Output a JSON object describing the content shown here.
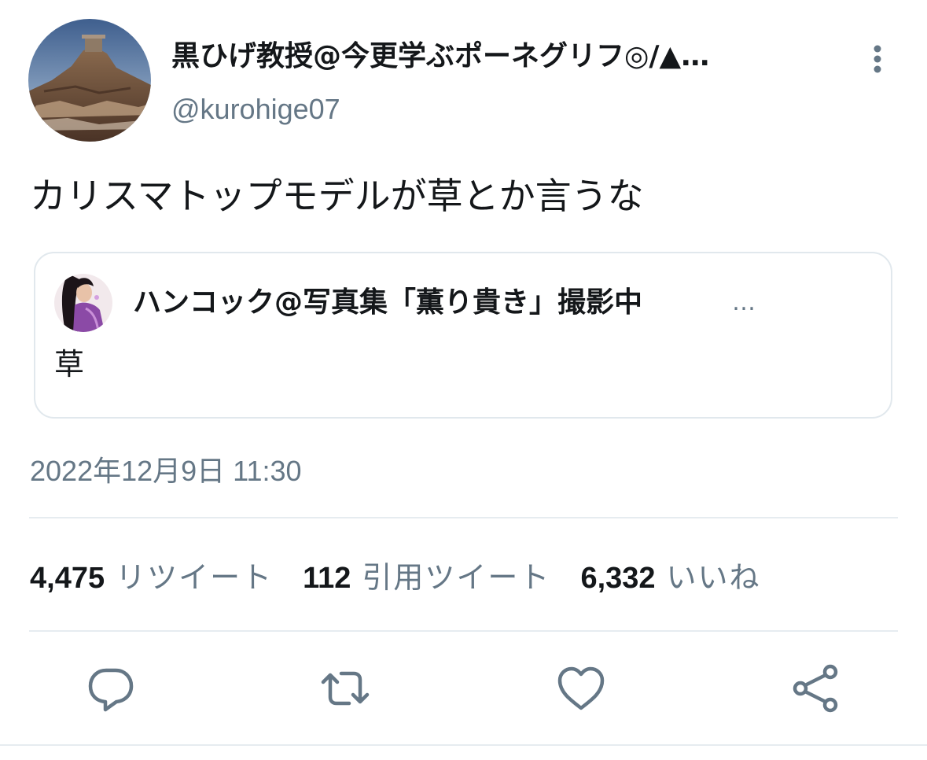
{
  "author": {
    "display_name": "黒ひげ教授@今更学ぶポーネグリフ◎/▲…",
    "handle": "@kurohige07",
    "avatar_icon": "landscape-avatar"
  },
  "more_icon": "more-vertical-icon",
  "tweet": {
    "text": "カリスマトップモデルが草とか言うな",
    "timestamp": "2022年12月9日 11:30"
  },
  "quote": {
    "display_name": "ハンコック@写真集「薫り貴き」撮影中",
    "ellipsis": "…",
    "text": "草",
    "avatar_icon": "character-avatar"
  },
  "stats": {
    "retweets": {
      "count": "4,475",
      "label": "リツイート"
    },
    "quotes": {
      "count": "112",
      "label": "引用ツイート"
    },
    "likes": {
      "count": "6,332",
      "label": "いいね"
    }
  },
  "actions": [
    {
      "name": "reply",
      "icon": "reply-icon"
    },
    {
      "name": "retweet",
      "icon": "retweet-icon"
    },
    {
      "name": "like",
      "icon": "heart-icon"
    },
    {
      "name": "share",
      "icon": "share-icon"
    }
  ],
  "colors": {
    "text_primary": "#14171a",
    "text_secondary": "#657786",
    "divider": "#e6ecf0",
    "icon": "#657786"
  }
}
